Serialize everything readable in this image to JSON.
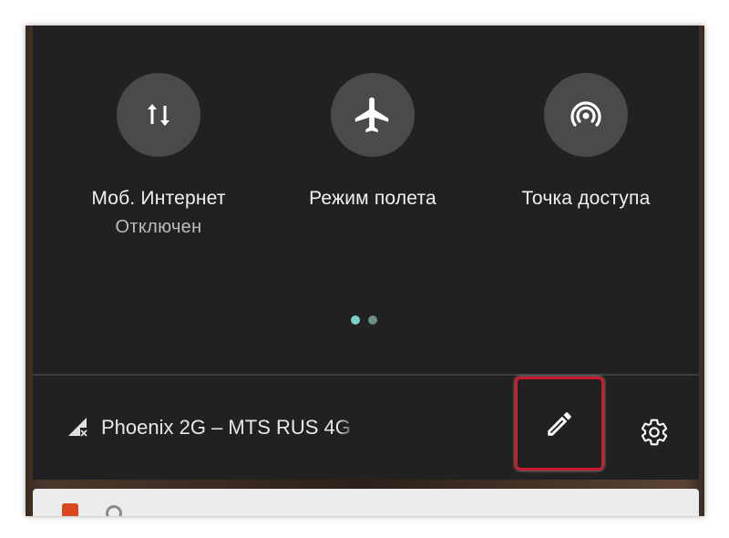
{
  "quick_settings": {
    "tiles": [
      {
        "label": "Моб. Интернет",
        "sub": "Отключен",
        "icon": "mobile-data-icon"
      },
      {
        "label": "Режим полета",
        "sub": "",
        "icon": "airplane-icon"
      },
      {
        "label": "Точка доступа",
        "sub": "",
        "icon": "hotspot-icon"
      }
    ],
    "page_dots": {
      "active": "#7fcfc9",
      "inactive": "#6b8e8c"
    }
  },
  "footer": {
    "network_label": "Phoenix 2G – MTS RUS 4G",
    "network_icon": "no-signal-icon",
    "edit_icon": "pencil-icon",
    "settings_icon": "gear-icon",
    "highlight_color": "#cc1b2e"
  },
  "notification": {
    "app_icon": "app-icon",
    "alarm_icon": "alarm-icon"
  }
}
